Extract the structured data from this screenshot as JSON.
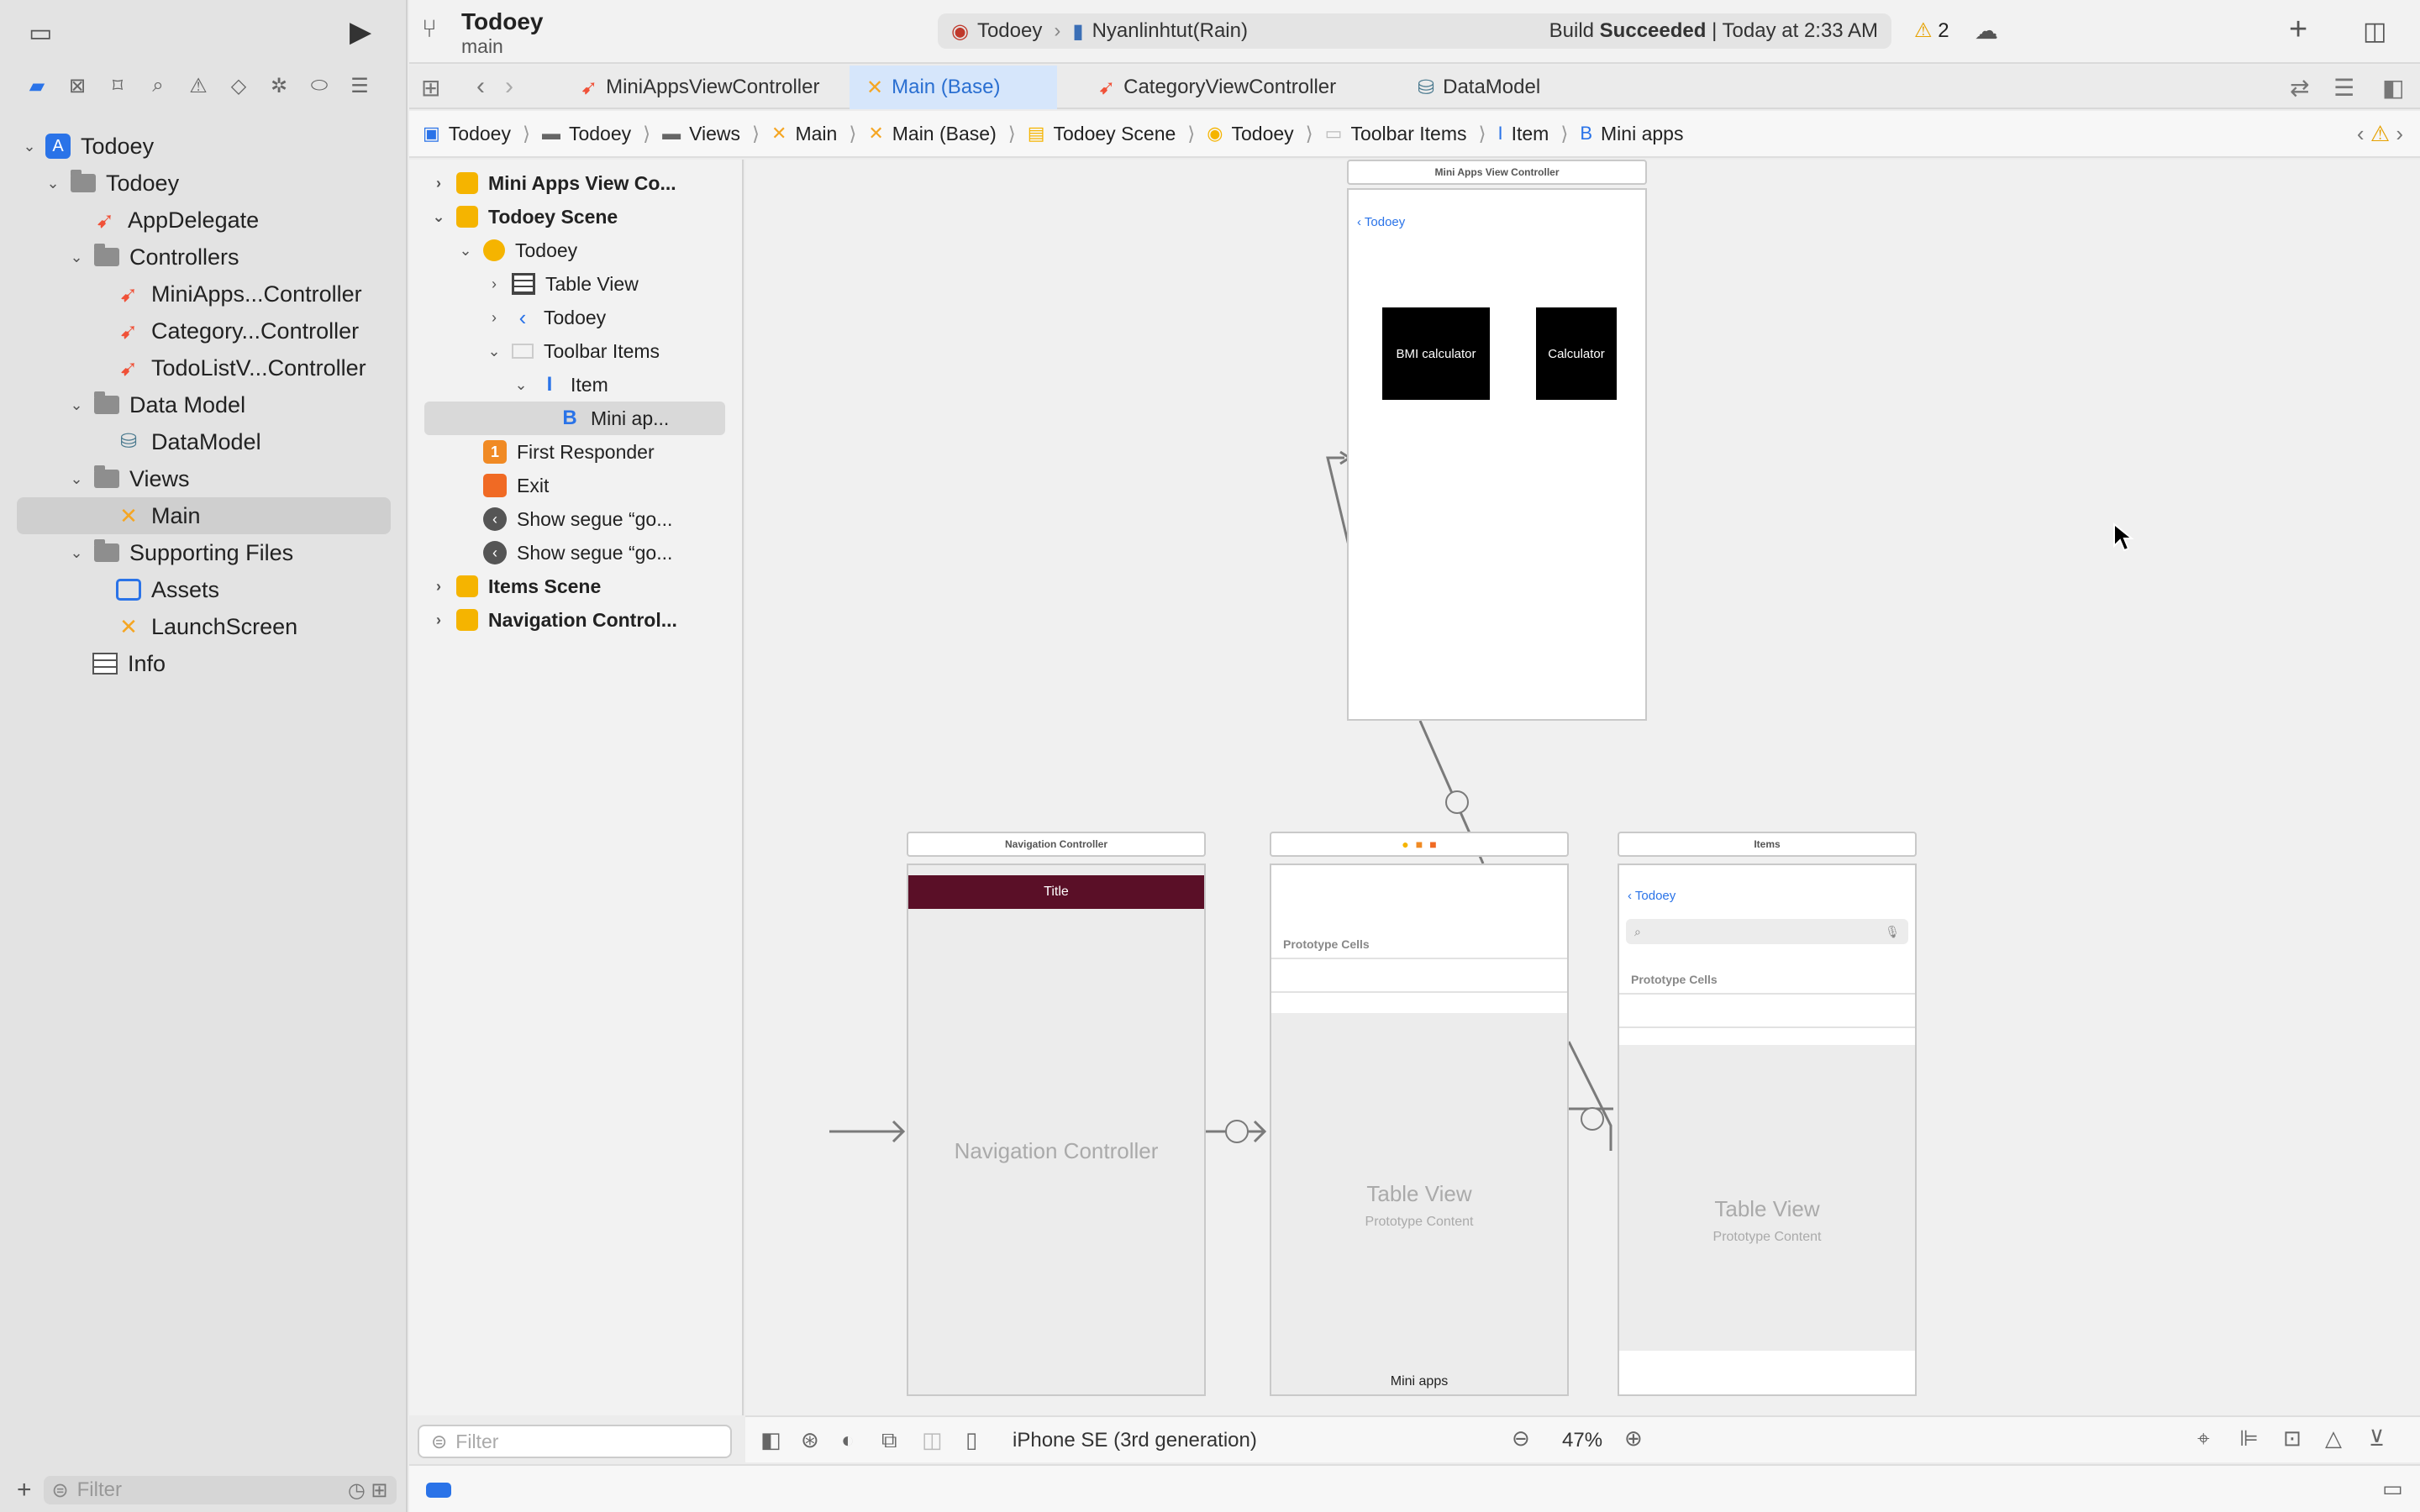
{
  "toolbar": {
    "project_title": "Todoey",
    "branch": "main",
    "scheme": {
      "app": "Todoey",
      "device": "Nyanlinhtut(Rain)",
      "status_prefix": "Build",
      "status_bold": "Succeeded",
      "status_suffix": "| Today at 2:33 AM",
      "warnings": "2"
    }
  },
  "tabs": [
    {
      "label": "MiniAppsViewController"
    },
    {
      "label": "Main (Base)"
    },
    {
      "label": "CategoryViewController"
    },
    {
      "label": "DataModel"
    }
  ],
  "jumpbar": [
    "Todoey",
    "Todoey",
    "Views",
    "Main",
    "Main (Base)",
    "Todoey Scene",
    "Todoey",
    "Toolbar Items",
    "Item",
    "Mini apps"
  ],
  "navigator": {
    "items": [
      {
        "label": "Todoey"
      },
      {
        "label": "Todoey"
      },
      {
        "label": "AppDelegate"
      },
      {
        "label": "Controllers"
      },
      {
        "label": "MiniApps...Controller"
      },
      {
        "label": "Category...Controller"
      },
      {
        "label": "TodoListV...Controller"
      },
      {
        "label": "Data Model"
      },
      {
        "label": "DataModel"
      },
      {
        "label": "Views"
      },
      {
        "label": "Main"
      },
      {
        "label": "Supporting Files"
      },
      {
        "label": "Assets"
      },
      {
        "label": "LaunchScreen"
      },
      {
        "label": "Info"
      }
    ],
    "filter_placeholder": "Filter"
  },
  "outline": {
    "items": [
      {
        "label": "Mini Apps View Co..."
      },
      {
        "label": "Todoey Scene"
      },
      {
        "label": "Todoey"
      },
      {
        "label": "Table View"
      },
      {
        "label": "Todoey"
      },
      {
        "label": "Toolbar Items"
      },
      {
        "label": "Item"
      },
      {
        "label": "Mini ap..."
      },
      {
        "label": "First Responder"
      },
      {
        "label": "Exit"
      },
      {
        "label": "Show segue “go..."
      },
      {
        "label": "Show segue “go..."
      },
      {
        "label": "Items Scene"
      },
      {
        "label": "Navigation Control..."
      }
    ],
    "filter_placeholder": "Filter"
  },
  "canvas": {
    "mini_apps": {
      "title": "Mini Apps View Controller",
      "back": "Todoey",
      "bmi": "BMI calculator",
      "calc": "Calculator"
    },
    "nav": {
      "title": "Navigation Controller",
      "bar_title": "Title",
      "label": "Navigation Controller"
    },
    "todoey": {
      "proto": "Prototype Cells",
      "table": "Table View",
      "content": "Prototype Content",
      "toolbar_item": "Mini apps"
    },
    "items": {
      "title": "Items",
      "back": "Todoey",
      "proto": "Prototype Cells",
      "table": "Table View",
      "content": "Prototype Content"
    }
  },
  "canvas_bar": {
    "device": "iPhone SE (3rd generation)",
    "zoom": "47%"
  }
}
